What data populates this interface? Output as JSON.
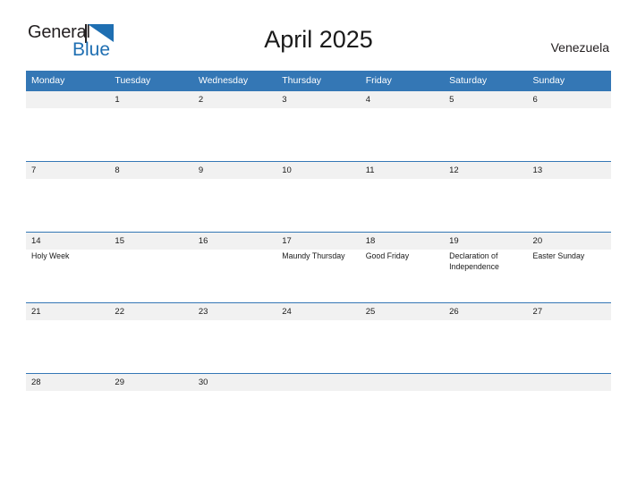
{
  "brand": {
    "name_primary": "General",
    "name_secondary": "Blue",
    "primary_color": "#231f20",
    "secondary_color": "#1f6fb2"
  },
  "header": {
    "title": "April 2025",
    "country": "Venezuela"
  },
  "calendar": {
    "header_bg": "#3477b5",
    "date_band_bg": "#f1f1f1",
    "weekdays": [
      "Monday",
      "Tuesday",
      "Wednesday",
      "Thursday",
      "Friday",
      "Saturday",
      "Sunday"
    ],
    "weeks": [
      [
        {
          "day": "",
          "event": ""
        },
        {
          "day": "1",
          "event": ""
        },
        {
          "day": "2",
          "event": ""
        },
        {
          "day": "3",
          "event": ""
        },
        {
          "day": "4",
          "event": ""
        },
        {
          "day": "5",
          "event": ""
        },
        {
          "day": "6",
          "event": ""
        }
      ],
      [
        {
          "day": "7",
          "event": ""
        },
        {
          "day": "8",
          "event": ""
        },
        {
          "day": "9",
          "event": ""
        },
        {
          "day": "10",
          "event": ""
        },
        {
          "day": "11",
          "event": ""
        },
        {
          "day": "12",
          "event": ""
        },
        {
          "day": "13",
          "event": ""
        }
      ],
      [
        {
          "day": "14",
          "event": "Holy Week"
        },
        {
          "day": "15",
          "event": ""
        },
        {
          "day": "16",
          "event": ""
        },
        {
          "day": "17",
          "event": "Maundy Thursday"
        },
        {
          "day": "18",
          "event": "Good Friday"
        },
        {
          "day": "19",
          "event": "Declaration of Independence"
        },
        {
          "day": "20",
          "event": "Easter Sunday"
        }
      ],
      [
        {
          "day": "21",
          "event": ""
        },
        {
          "day": "22",
          "event": ""
        },
        {
          "day": "23",
          "event": ""
        },
        {
          "day": "24",
          "event": ""
        },
        {
          "day": "25",
          "event": ""
        },
        {
          "day": "26",
          "event": ""
        },
        {
          "day": "27",
          "event": ""
        }
      ],
      [
        {
          "day": "28",
          "event": ""
        },
        {
          "day": "29",
          "event": ""
        },
        {
          "day": "30",
          "event": ""
        },
        {
          "day": "",
          "event": ""
        },
        {
          "day": "",
          "event": ""
        },
        {
          "day": "",
          "event": ""
        },
        {
          "day": "",
          "event": ""
        }
      ]
    ]
  }
}
